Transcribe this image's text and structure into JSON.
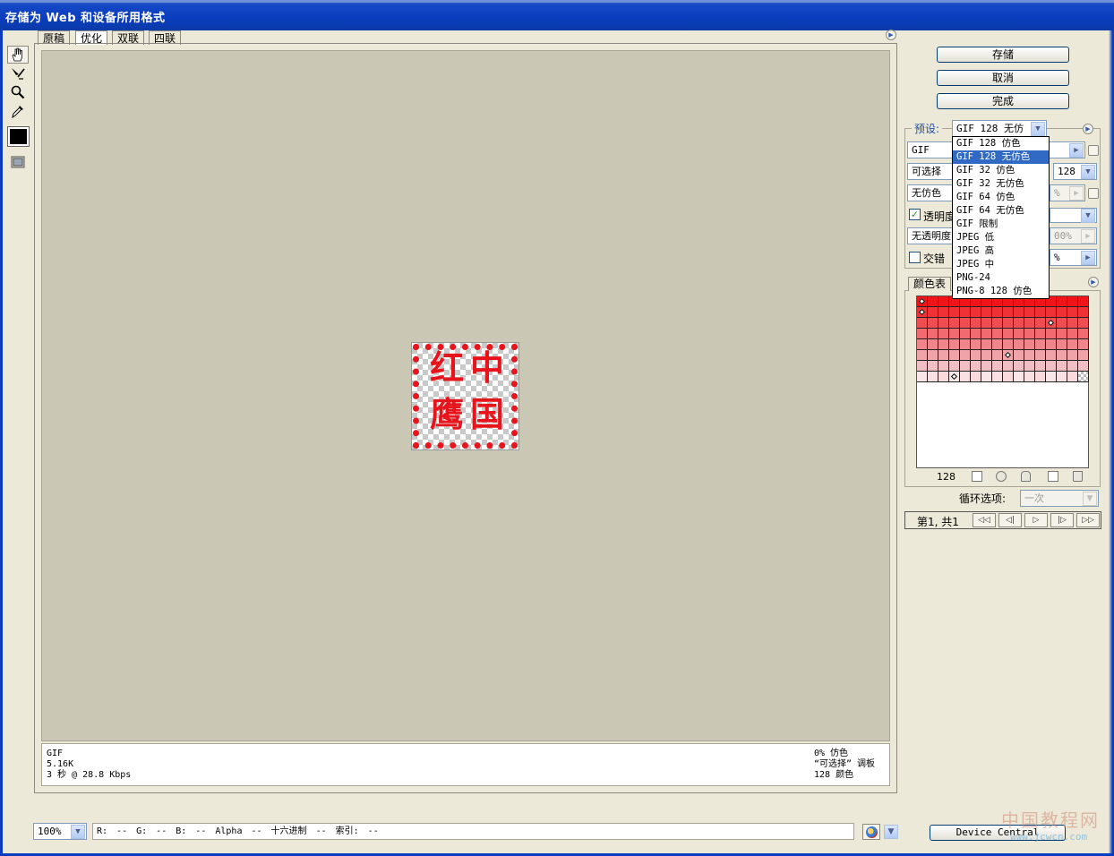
{
  "window": {
    "title": "存储为 Web 和设备所用格式"
  },
  "tabs": [
    {
      "label": "原稿"
    },
    {
      "label": "优化"
    },
    {
      "label": "双联"
    },
    {
      "label": "四联"
    }
  ],
  "preview": {
    "image_text": [
      "红",
      "中",
      "鹰",
      "国"
    ],
    "info_left": [
      "GIF",
      "5.16K",
      "3 秒 @ 28.8 Kbps"
    ],
    "info_right": [
      "0% 仿色",
      "“可选择” 调板",
      "128 颜色"
    ]
  },
  "buttons": {
    "save": "存储",
    "cancel": "取消",
    "done": "完成"
  },
  "settings": {
    "preset_label": "预设:",
    "preset_value": "GIF 128 无仿色",
    "format_value": "GIF",
    "palette_value": "可选择",
    "colors_value": "128",
    "dither_value": "无仿色",
    "dither_pct": "%",
    "transparency_label": "透明度",
    "transparency_checked": true,
    "matte_dither_value": "无透明度",
    "matte_pct": "00%",
    "interlace_label": "交错",
    "interlace_checked": false,
    "lossy_pct": "%"
  },
  "preset_options": [
    "GIF 128 仿色",
    "GIF 128 无仿色",
    "GIF 32 仿色",
    "GIF 32 无仿色",
    "GIF 64 仿色",
    "GIF 64 无仿色",
    "GIF 限制",
    "JPEG 低",
    "JPEG 高",
    "JPEG 中",
    "PNG-24",
    "PNG-8 128 仿色"
  ],
  "preset_selected_index": 1,
  "color_table": {
    "tab_label": "颜色表",
    "count": "128"
  },
  "loop": {
    "label": "循环选项:",
    "value": "一次"
  },
  "animation": {
    "frame_label": "第1, 共1"
  },
  "status": {
    "zoom": "100%",
    "readout": "R: -- G: -- B: -- Alpha -- 十六进制 -- 索引: --",
    "device_central": "Device Central"
  },
  "watermark": {
    "text": "中国教程网",
    "url": "www.jcwcn.com"
  },
  "colors": {
    "title_blue": "#0a3dbd",
    "canvas": "#cbc7b5",
    "selection": "#316ac5",
    "stamp_red": "#e8141b"
  }
}
